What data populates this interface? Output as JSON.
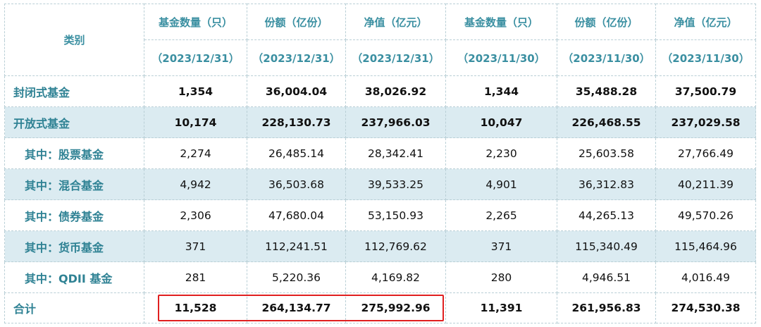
{
  "header": {
    "category": "类别",
    "columns": [
      {
        "title": "基金数量（只）",
        "date": "（2023/12/31）"
      },
      {
        "title": "份额（亿份）",
        "date": "（2023/12/31）"
      },
      {
        "title": "净值（亿元）",
        "date": "（2023/12/31）"
      },
      {
        "title": "基金数量（只）",
        "date": "（2023/11/30）"
      },
      {
        "title": "份额（亿份）",
        "date": "（2023/11/30）"
      },
      {
        "title": "净值（亿元）",
        "date": "（2023/11/30）"
      }
    ]
  },
  "rows": [
    {
      "label": "封闭式基金",
      "values": [
        "1,354",
        "36,004.04",
        "38,026.92",
        "1,344",
        "35,488.28",
        "37,500.79"
      ]
    },
    {
      "label": "开放式基金",
      "values": [
        "10,174",
        "228,130.73",
        "237,966.03",
        "10,047",
        "226,468.55",
        "237,029.58"
      ]
    },
    {
      "label": "其中：股票基金",
      "values": [
        "2,274",
        "26,485.14",
        "28,342.41",
        "2,230",
        "25,603.58",
        "27,766.49"
      ]
    },
    {
      "label": "其中：混合基金",
      "values": [
        "4,942",
        "36,503.68",
        "39,533.25",
        "4,901",
        "36,312.83",
        "40,211.39"
      ]
    },
    {
      "label": "其中：债券基金",
      "values": [
        "2,306",
        "47,680.04",
        "53,150.93",
        "2,265",
        "44,265.13",
        "49,570.26"
      ]
    },
    {
      "label": "其中：货币基金",
      "values": [
        "371",
        "112,241.51",
        "112,769.62",
        "371",
        "115,340.49",
        "115,464.96"
      ]
    },
    {
      "label": "其中：QDII 基金",
      "values": [
        "281",
        "5,220.36",
        "4,169.82",
        "280",
        "4,946.51",
        "4,016.49"
      ]
    },
    {
      "label": "合计",
      "values": [
        "11,528",
        "264,134.77",
        "275,992.96",
        "11,391",
        "261,956.83",
        "274,530.38"
      ]
    }
  ],
  "colors": {
    "header_text": "#3a8fa1",
    "label_text": "#2f8294",
    "shade": "#dbebf1",
    "highlight": "#e02020"
  }
}
